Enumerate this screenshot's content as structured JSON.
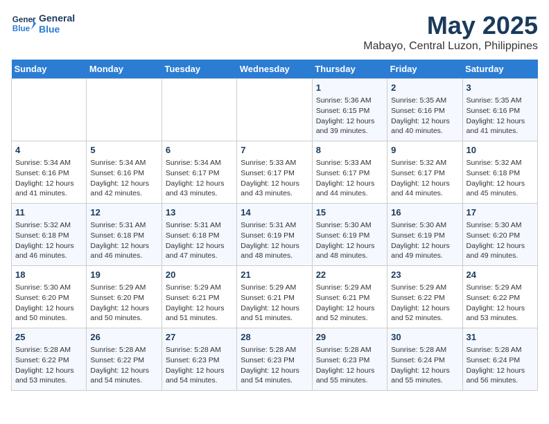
{
  "logo": {
    "line1": "General",
    "line2": "Blue"
  },
  "title": "May 2025",
  "subtitle": "Mabayo, Central Luzon, Philippines",
  "days_of_week": [
    "Sunday",
    "Monday",
    "Tuesday",
    "Wednesday",
    "Thursday",
    "Friday",
    "Saturday"
  ],
  "weeks": [
    [
      {
        "day": "",
        "content": ""
      },
      {
        "day": "",
        "content": ""
      },
      {
        "day": "",
        "content": ""
      },
      {
        "day": "",
        "content": ""
      },
      {
        "day": "1",
        "content": "Sunrise: 5:36 AM\nSunset: 6:15 PM\nDaylight: 12 hours\nand 39 minutes."
      },
      {
        "day": "2",
        "content": "Sunrise: 5:35 AM\nSunset: 6:16 PM\nDaylight: 12 hours\nand 40 minutes."
      },
      {
        "day": "3",
        "content": "Sunrise: 5:35 AM\nSunset: 6:16 PM\nDaylight: 12 hours\nand 41 minutes."
      }
    ],
    [
      {
        "day": "4",
        "content": "Sunrise: 5:34 AM\nSunset: 6:16 PM\nDaylight: 12 hours\nand 41 minutes."
      },
      {
        "day": "5",
        "content": "Sunrise: 5:34 AM\nSunset: 6:16 PM\nDaylight: 12 hours\nand 42 minutes."
      },
      {
        "day": "6",
        "content": "Sunrise: 5:34 AM\nSunset: 6:17 PM\nDaylight: 12 hours\nand 43 minutes."
      },
      {
        "day": "7",
        "content": "Sunrise: 5:33 AM\nSunset: 6:17 PM\nDaylight: 12 hours\nand 43 minutes."
      },
      {
        "day": "8",
        "content": "Sunrise: 5:33 AM\nSunset: 6:17 PM\nDaylight: 12 hours\nand 44 minutes."
      },
      {
        "day": "9",
        "content": "Sunrise: 5:32 AM\nSunset: 6:17 PM\nDaylight: 12 hours\nand 44 minutes."
      },
      {
        "day": "10",
        "content": "Sunrise: 5:32 AM\nSunset: 6:18 PM\nDaylight: 12 hours\nand 45 minutes."
      }
    ],
    [
      {
        "day": "11",
        "content": "Sunrise: 5:32 AM\nSunset: 6:18 PM\nDaylight: 12 hours\nand 46 minutes."
      },
      {
        "day": "12",
        "content": "Sunrise: 5:31 AM\nSunset: 6:18 PM\nDaylight: 12 hours\nand 46 minutes."
      },
      {
        "day": "13",
        "content": "Sunrise: 5:31 AM\nSunset: 6:18 PM\nDaylight: 12 hours\nand 47 minutes."
      },
      {
        "day": "14",
        "content": "Sunrise: 5:31 AM\nSunset: 6:19 PM\nDaylight: 12 hours\nand 48 minutes."
      },
      {
        "day": "15",
        "content": "Sunrise: 5:30 AM\nSunset: 6:19 PM\nDaylight: 12 hours\nand 48 minutes."
      },
      {
        "day": "16",
        "content": "Sunrise: 5:30 AM\nSunset: 6:19 PM\nDaylight: 12 hours\nand 49 minutes."
      },
      {
        "day": "17",
        "content": "Sunrise: 5:30 AM\nSunset: 6:20 PM\nDaylight: 12 hours\nand 49 minutes."
      }
    ],
    [
      {
        "day": "18",
        "content": "Sunrise: 5:30 AM\nSunset: 6:20 PM\nDaylight: 12 hours\nand 50 minutes."
      },
      {
        "day": "19",
        "content": "Sunrise: 5:29 AM\nSunset: 6:20 PM\nDaylight: 12 hours\nand 50 minutes."
      },
      {
        "day": "20",
        "content": "Sunrise: 5:29 AM\nSunset: 6:21 PM\nDaylight: 12 hours\nand 51 minutes."
      },
      {
        "day": "21",
        "content": "Sunrise: 5:29 AM\nSunset: 6:21 PM\nDaylight: 12 hours\nand 51 minutes."
      },
      {
        "day": "22",
        "content": "Sunrise: 5:29 AM\nSunset: 6:21 PM\nDaylight: 12 hours\nand 52 minutes."
      },
      {
        "day": "23",
        "content": "Sunrise: 5:29 AM\nSunset: 6:22 PM\nDaylight: 12 hours\nand 52 minutes."
      },
      {
        "day": "24",
        "content": "Sunrise: 5:29 AM\nSunset: 6:22 PM\nDaylight: 12 hours\nand 53 minutes."
      }
    ],
    [
      {
        "day": "25",
        "content": "Sunrise: 5:28 AM\nSunset: 6:22 PM\nDaylight: 12 hours\nand 53 minutes."
      },
      {
        "day": "26",
        "content": "Sunrise: 5:28 AM\nSunset: 6:22 PM\nDaylight: 12 hours\nand 54 minutes."
      },
      {
        "day": "27",
        "content": "Sunrise: 5:28 AM\nSunset: 6:23 PM\nDaylight: 12 hours\nand 54 minutes."
      },
      {
        "day": "28",
        "content": "Sunrise: 5:28 AM\nSunset: 6:23 PM\nDaylight: 12 hours\nand 54 minutes."
      },
      {
        "day": "29",
        "content": "Sunrise: 5:28 AM\nSunset: 6:23 PM\nDaylight: 12 hours\nand 55 minutes."
      },
      {
        "day": "30",
        "content": "Sunrise: 5:28 AM\nSunset: 6:24 PM\nDaylight: 12 hours\nand 55 minutes."
      },
      {
        "day": "31",
        "content": "Sunrise: 5:28 AM\nSunset: 6:24 PM\nDaylight: 12 hours\nand 56 minutes."
      }
    ]
  ]
}
